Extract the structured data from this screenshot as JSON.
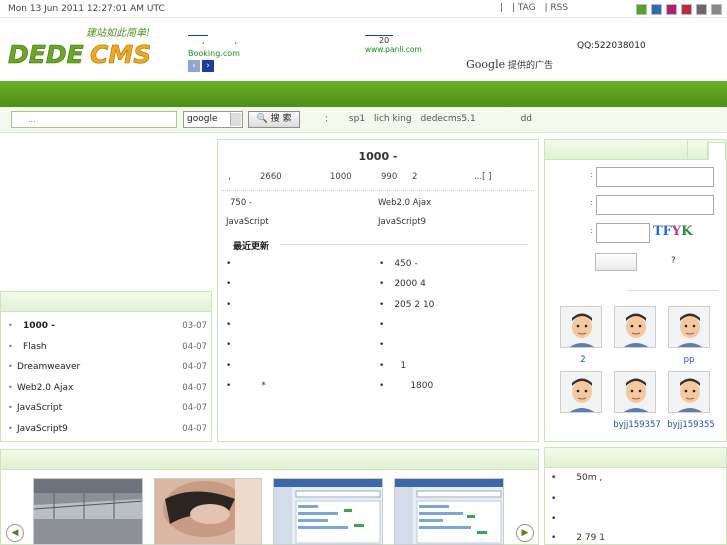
{
  "topbar": {
    "datetime": "Mon 13 Jun 2011 12:27:01 AM UTC",
    "links": [
      "|",
      "| TAG",
      "| RSS"
    ],
    "swatches": [
      "#5aa02c",
      "#2b6cb3",
      "#b2206e",
      "#c0283c",
      "#6a6a6a",
      "#8a8a8a"
    ]
  },
  "header": {
    "logo_tagline": "建站如此简单!",
    "logo_text": "DEDECMS",
    "ad_left": {
      "line1": ",",
      "line2": ",",
      "site": "Booking.com"
    },
    "ad_mid": {
      "num": "20",
      "site": "www.panli.com"
    },
    "google_ad": {
      "brand": "Google",
      "label": "提供的广告"
    },
    "qq": "QQ:522038010"
  },
  "search": {
    "placeholder": "...",
    "engine": "google",
    "button": "搜 索",
    "hot_prefix": ":",
    "hot_words": [
      "sp1",
      "lich king",
      "dedecms5.1",
      "dd"
    ]
  },
  "left_list": {
    "items": [
      {
        "title": "1000 -",
        "date": "03-07",
        "bold": true
      },
      {
        "title": "Flash",
        "date": "04-07"
      },
      {
        "title": "Dreamweaver",
        "date": "04-07"
      },
      {
        "title": "Web2.0 Ajax",
        "date": "04-07"
      },
      {
        "title": "JavaScript",
        "date": "04-07"
      },
      {
        "title": "JavaScript9",
        "date": "04-07"
      }
    ]
  },
  "center": {
    "headline": "1000 -",
    "subline_parts": [
      ",",
      "2660",
      "1000",
      "990",
      "2",
      "...[ ]"
    ],
    "row1": [
      "750 -",
      "Web2.0 Ajax"
    ],
    "row2": [
      "JavaScript",
      "JavaScript9"
    ],
    "latest_label": "最近更新",
    "left_bullets": [
      "",
      "",
      "",
      "",
      "",
      "",
      "*"
    ],
    "right_bullets": [
      "450 -",
      "2000 4",
      "205 2 10",
      "",
      "",
      "1",
      "1800"
    ]
  },
  "right": {
    "captcha": "TFYK",
    "question": "?",
    "users": [
      {
        "name": "2"
      },
      {
        "name": ""
      },
      {
        "name": "pp"
      },
      {
        "name": ""
      },
      {
        "name": "byjj159357"
      },
      {
        "name": "byjj159355"
      }
    ]
  },
  "bottom_right": {
    "items": [
      "50m ,",
      "",
      "",
      "2 79 1"
    ]
  }
}
